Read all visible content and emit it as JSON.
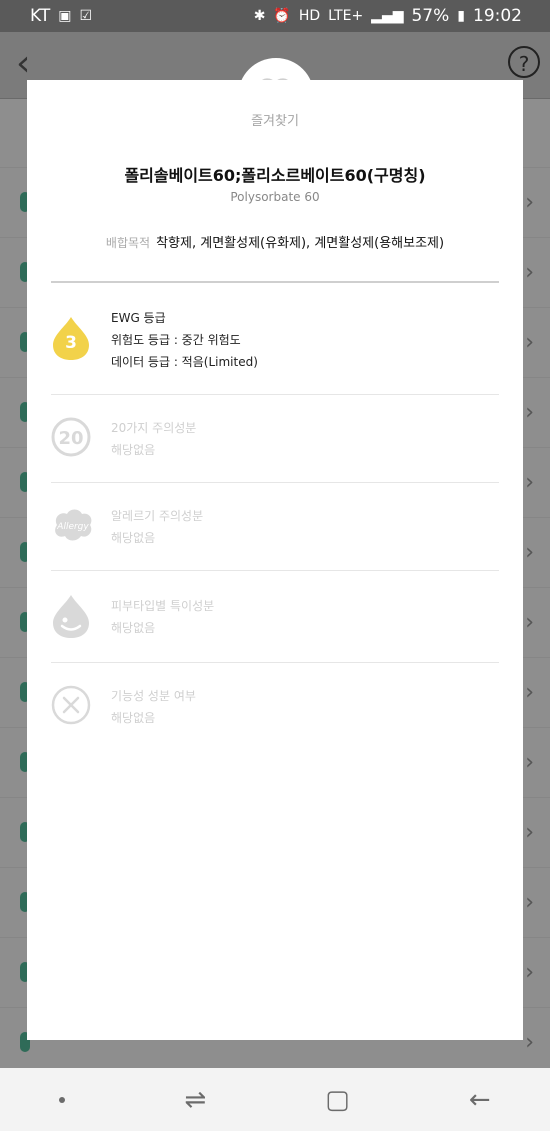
{
  "status_bar": {
    "carrier": "KT",
    "icons_left": [
      "notification-icon",
      "checkbox-icon"
    ],
    "icons_right": [
      "bluetooth-icon",
      "alarm-icon",
      "hd-icon",
      "lte-icon",
      "signal-icon"
    ],
    "network": "LTE+",
    "battery": "57%",
    "time": "19:02"
  },
  "appbar": {
    "back_icon": "chevron-left-icon",
    "help_label": "?"
  },
  "modal": {
    "favorite_label": "즐겨찾기",
    "title": "폴리솔베이트60;폴리소르베이트60(구명칭)",
    "subtitle": "Polysorbate 60",
    "purpose_label": "배합목적",
    "purpose_value": "착향제, 계면활성제(유화제), 계면활성제(용해보조제)",
    "ewg": {
      "heading": "EWG 등급",
      "grade": "3",
      "risk": "위험도 등급 : 중간 위험도",
      "data": "데이터 등급 : 적음(Limited)",
      "color": "#f2d24a"
    },
    "caution20": {
      "heading": "20가지 주의성분",
      "value": "해당없음",
      "icon_label": "20"
    },
    "allergy": {
      "heading": "알레르기 주의성분",
      "value": "해당없음",
      "icon_label": "Allergy"
    },
    "skin": {
      "heading": "피부타입별 특이성분",
      "value": "해당없음"
    },
    "functional": {
      "heading": "기능성 성분 여부",
      "value": "해당없음"
    }
  },
  "colors": {
    "overlay": "#8e8e8e",
    "inactive_icon": "#d9d9d9",
    "modal_bg": "#ffffff"
  }
}
